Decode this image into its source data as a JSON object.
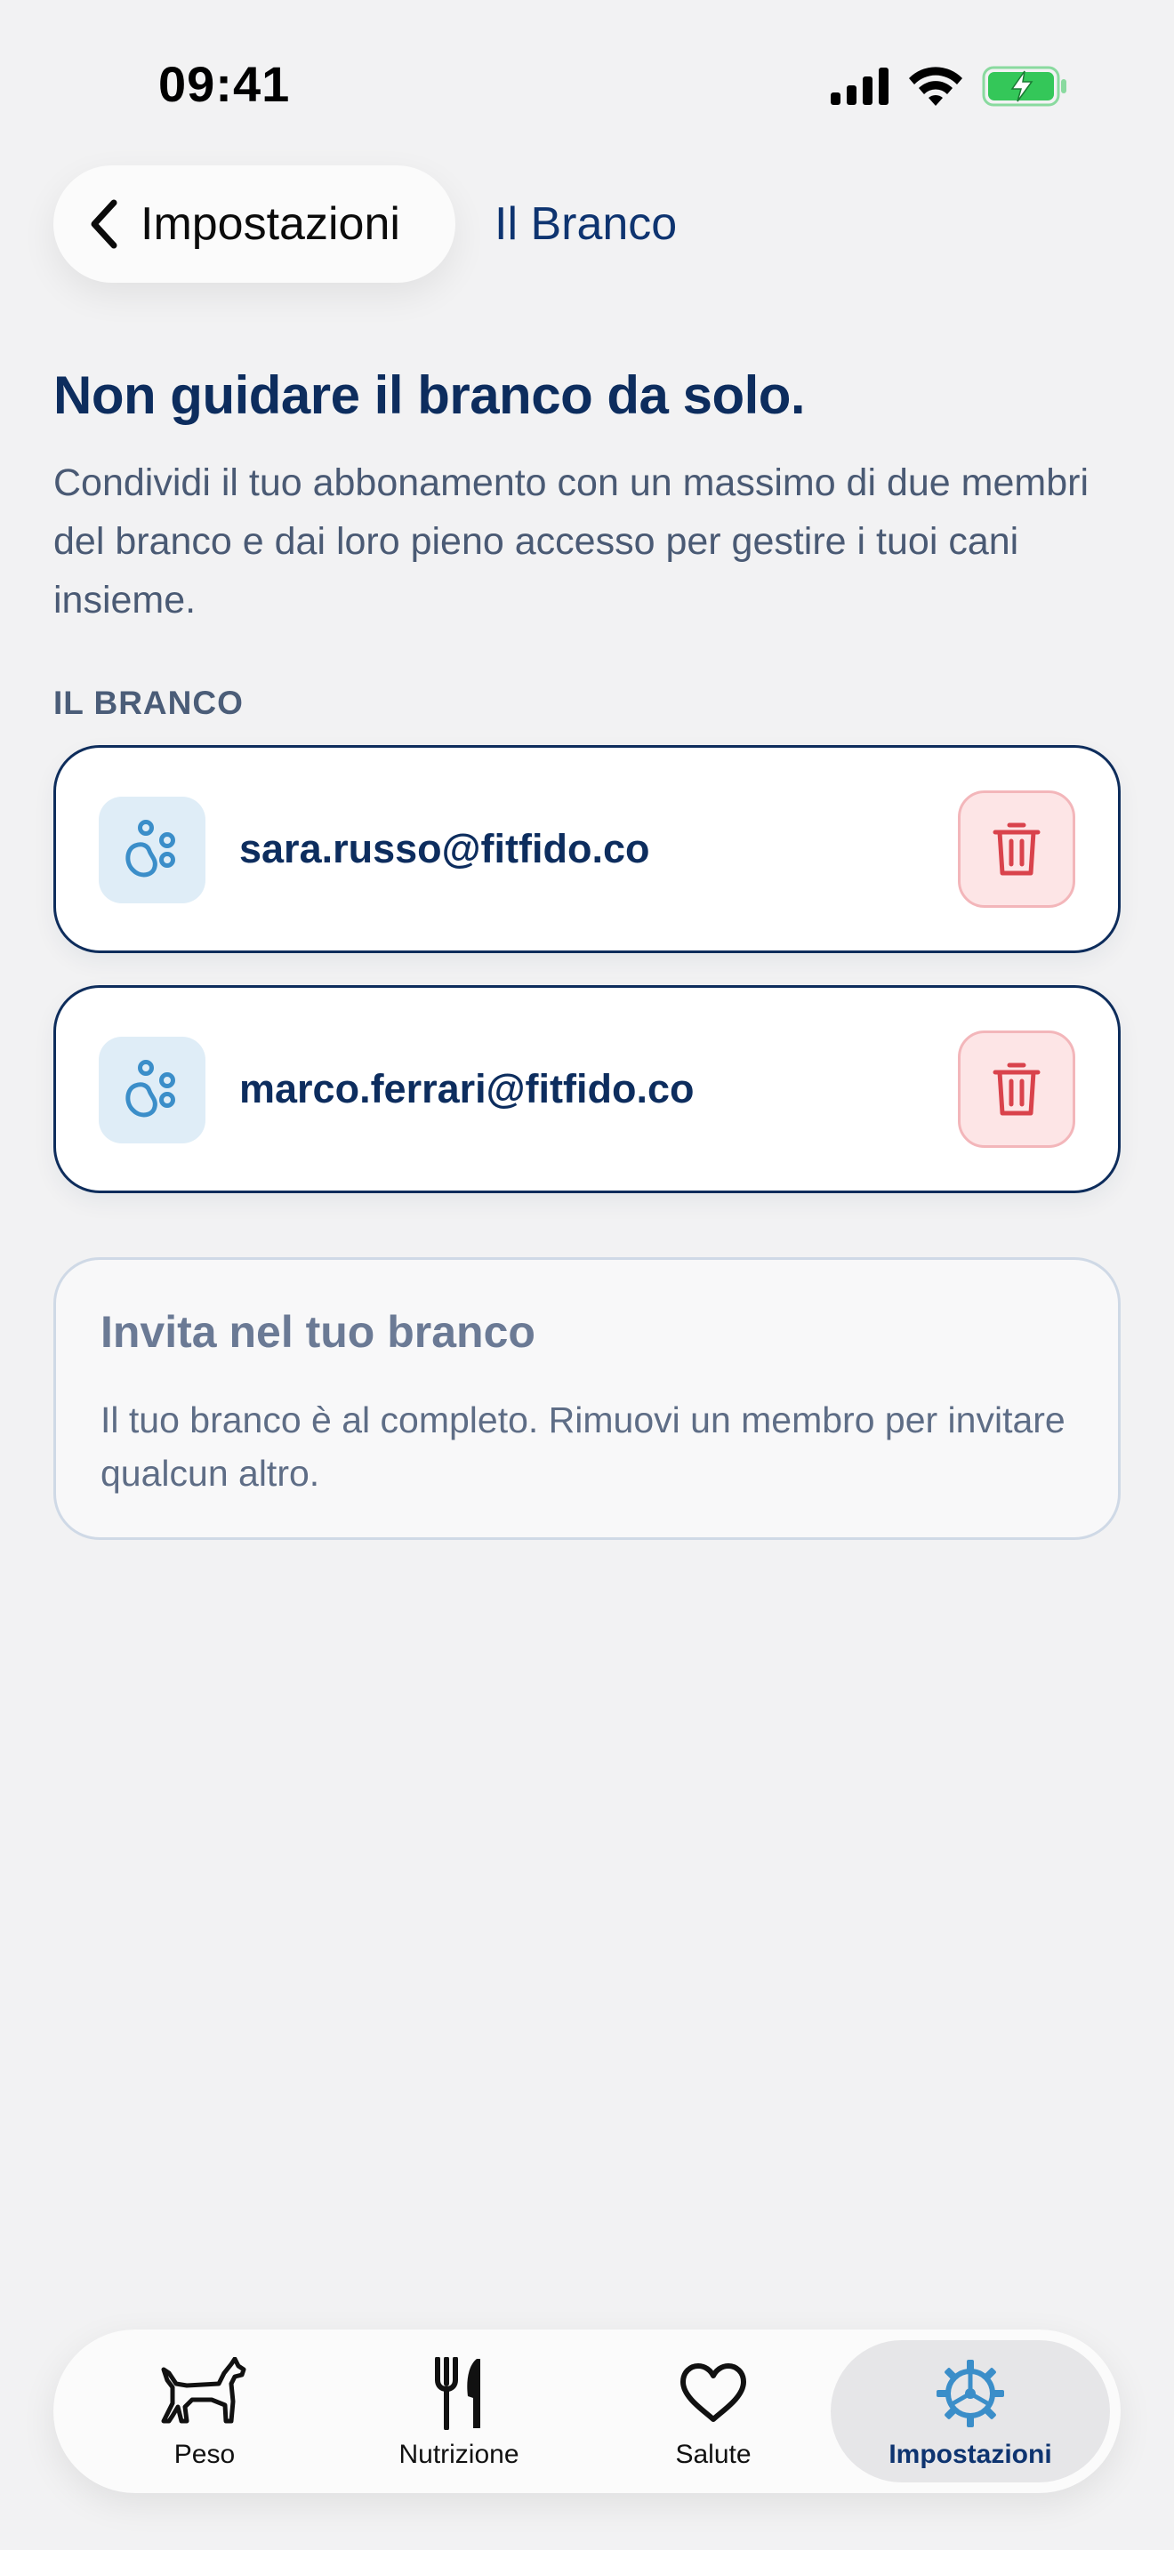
{
  "status_bar": {
    "time": "09:41"
  },
  "header": {
    "back_label": "Impostazioni",
    "title": "Il Branco"
  },
  "intro": {
    "headline": "Non guidare il branco da solo.",
    "description": "Condividi il tuo abbonamento con un massimo di due membri del branco e dai loro pieno accesso per gestire i tuoi cani insieme."
  },
  "members_section": {
    "label": "IL BRANCO",
    "members": [
      {
        "email": "sara.russo@fitfido.co"
      },
      {
        "email": "marco.ferrari@fitfido.co"
      }
    ]
  },
  "invite": {
    "title": "Invita nel tuo branco",
    "description": "Il tuo branco è al completo. Rimuovi un membro per invitare qualcun altro."
  },
  "tab_bar": {
    "tabs": [
      {
        "label": "Peso",
        "icon": "dog-icon"
      },
      {
        "label": "Nutrizione",
        "icon": "fork-knife-icon"
      },
      {
        "label": "Salute",
        "icon": "heart-icon"
      },
      {
        "label": "Impostazioni",
        "icon": "gear-icon",
        "selected": true
      }
    ]
  },
  "colors": {
    "primary": "#0d2d5e",
    "accent_blue": "#3b8ec9",
    "danger": "#d9434c",
    "battery": "#34c759"
  }
}
